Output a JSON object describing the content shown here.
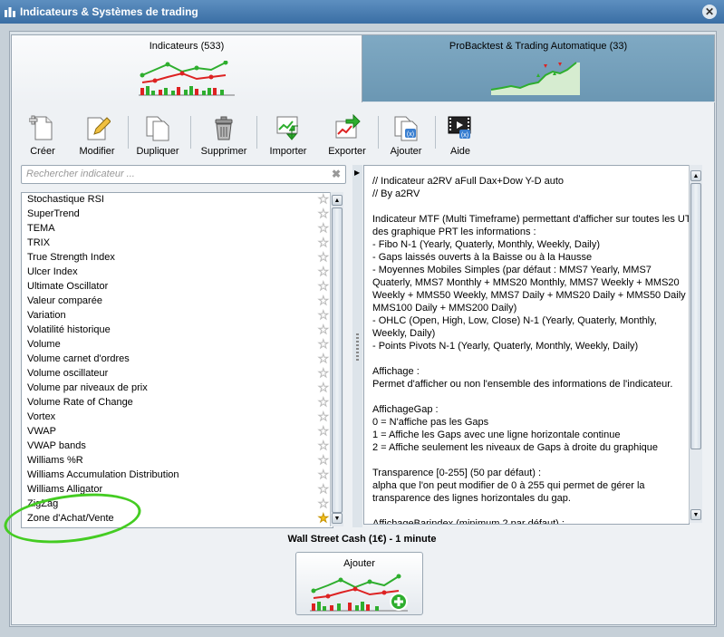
{
  "window": {
    "title": "Indicateurs & Systèmes de trading",
    "close_glyph": "✕"
  },
  "tabs": [
    {
      "label": "Indicateurs (533)",
      "active": true
    },
    {
      "label": "ProBacktest & Trading Automatique (33)",
      "active": false
    }
  ],
  "toolbar": [
    {
      "label": "Créer",
      "icon": "create-icon"
    },
    {
      "label": "Modifier",
      "icon": "edit-icon"
    },
    {
      "label": "Dupliquer",
      "icon": "duplicate-icon"
    },
    {
      "label": "Supprimer",
      "icon": "trash-icon"
    },
    {
      "label": "Importer",
      "icon": "import-icon"
    },
    {
      "label": "Exporter",
      "icon": "export-icon"
    },
    {
      "label": "Ajouter",
      "icon": "add-icon"
    },
    {
      "label": "Aide",
      "icon": "help-video-icon"
    }
  ],
  "search": {
    "placeholder": "Rechercher indicateur ...",
    "clear_glyph": "✖"
  },
  "indicators": [
    {
      "name": "Stochastique RSI",
      "favorite": false
    },
    {
      "name": "SuperTrend",
      "favorite": false
    },
    {
      "name": "TEMA",
      "favorite": false
    },
    {
      "name": "TRIX",
      "favorite": false
    },
    {
      "name": "True Strength Index",
      "favorite": false
    },
    {
      "name": "Ulcer Index",
      "favorite": false
    },
    {
      "name": "Ultimate Oscillator",
      "favorite": false
    },
    {
      "name": "Valeur comparée",
      "favorite": false
    },
    {
      "name": "Variation",
      "favorite": false
    },
    {
      "name": "Volatilité historique",
      "favorite": false
    },
    {
      "name": "Volume",
      "favorite": false
    },
    {
      "name": "Volume carnet d'ordres",
      "favorite": false
    },
    {
      "name": "Volume oscillateur",
      "favorite": false
    },
    {
      "name": "Volume par niveaux de prix",
      "favorite": false
    },
    {
      "name": "Volume Rate of Change",
      "favorite": false
    },
    {
      "name": "Vortex",
      "favorite": false
    },
    {
      "name": "VWAP",
      "favorite": false
    },
    {
      "name": "VWAP bands",
      "favorite": false
    },
    {
      "name": "Williams %R",
      "favorite": false
    },
    {
      "name": "Williams Accumulation Distribution",
      "favorite": false
    },
    {
      "name": "Williams Alligator",
      "favorite": false
    },
    {
      "name": "ZigZag",
      "favorite": false
    },
    {
      "name": "Zone d'Achat/Vente",
      "favorite": true
    }
  ],
  "description": [
    "// Indicateur a2RV aFull Dax+Dow Y-D auto",
    "// By a2RV",
    "",
    "Indicateur MTF (Multi Timeframe) permettant d'afficher sur toutes les UT",
    "des graphique PRT les informations :",
    "- Fibo N-1 (Yearly, Quaterly, Monthly, Weekly, Daily)",
    "- Gaps laissés ouverts à la Baisse ou à la Hausse",
    "- Moyennes Mobiles Simples (par défaut : MMS7 Yearly, MMS7",
    "Quaterly, MMS7 Monthly + MMS20 Monthly, MMS7 Weekly + MMS20",
    "Weekly + MMS50 Weekly, MMS7 Daily + MMS20 Daily + MMS50 Daily +",
    "MMS100 Daily + MMS200 Daily)",
    "- OHLC (Open, High, Low, Close) N-1 (Yearly, Quaterly, Monthly,",
    "Weekly, Daily)",
    "- Points Pivots N-1 (Yearly, Quaterly, Monthly, Weekly, Daily)",
    "",
    "Affichage :",
    "Permet d'afficher ou non l'ensemble des informations de l'indicateur.",
    "",
    "AffichageGap :",
    "0 = N'affiche pas les Gaps",
    "1 = Affiche les Gaps avec une ligne horizontale continue",
    "2 = Affiche seulement les niveaux de Gaps à droite du graphique",
    "",
    "Transparence [0-255] (50 par défaut) :",
    "alpha que l'on peut modifier de 0 à 255 qui permet de gérer la",
    "transparence des lignes horizontales du gap.",
    "",
    "AffichageBarindex (minimum 2 par défaut) :"
  ],
  "instrument_caption": "Wall Street Cash (1€) - 1 minute",
  "add_button": {
    "label": "Ajouter"
  },
  "colors": {
    "title_bar": "#3a6ea4",
    "highlight_ellipse": "#44cc22",
    "favorite_star": "#f4c21d"
  }
}
